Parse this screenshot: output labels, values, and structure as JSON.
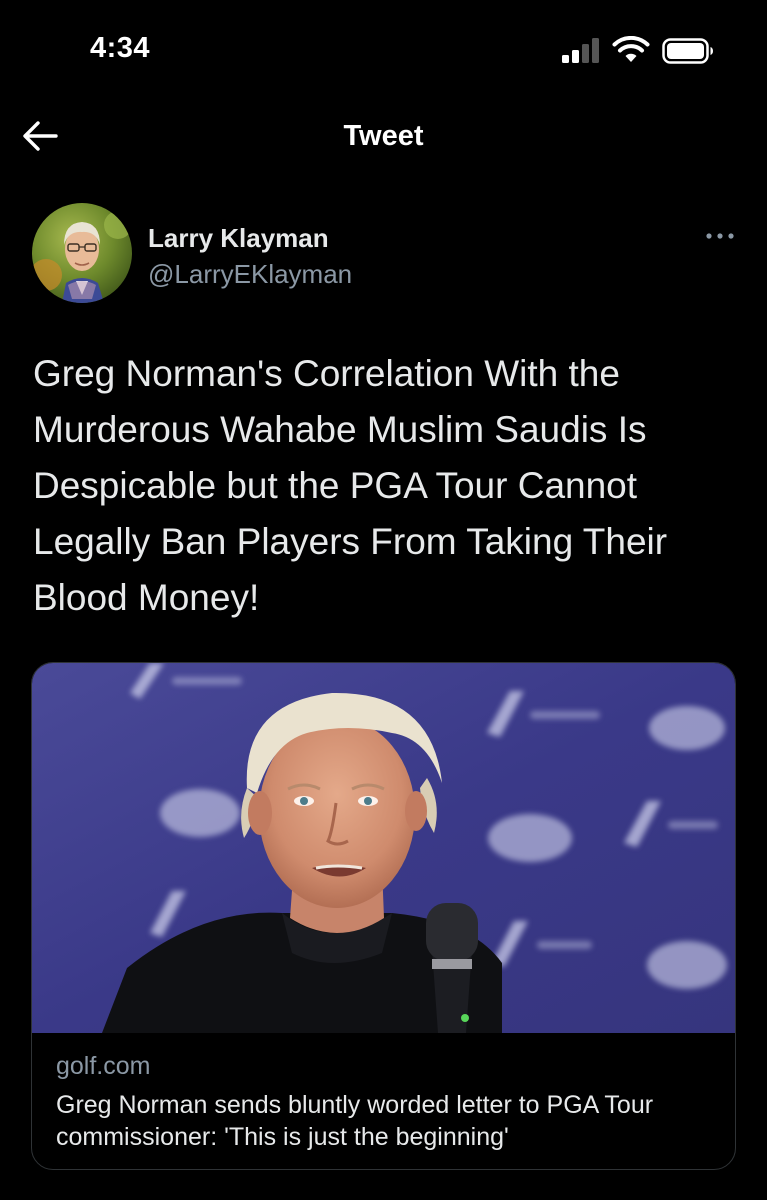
{
  "status_bar": {
    "time": "4:34",
    "signal_icon": "cellular-signal-icon",
    "wifi_icon": "wifi-icon",
    "battery_icon": "battery-icon"
  },
  "nav": {
    "back_icon": "back-arrow-icon",
    "title": "Tweet"
  },
  "tweet": {
    "author": {
      "name": "Larry Klayman",
      "handle": "@LarryEKlayman",
      "avatar": "avatar"
    },
    "more_icon": "more-options-icon",
    "text": "Greg Norman's Correlation With the Murderous Wahabe Muslim Saudis Is Despicable but the PGA Tour Cannot Legally Ban Players From Taking Their Blood Money!",
    "link_card": {
      "domain": "golf.com",
      "title": "Greg Norman sends bluntly worded letter to PGA Tour commissioner: 'This is just the beginning'"
    }
  },
  "colors": {
    "background": "#000000",
    "primary_text": "#e7e9ea",
    "secondary_text": "#8b98a5",
    "card_border": "#2f3336",
    "backdrop_blue": "#3e3d8c"
  }
}
